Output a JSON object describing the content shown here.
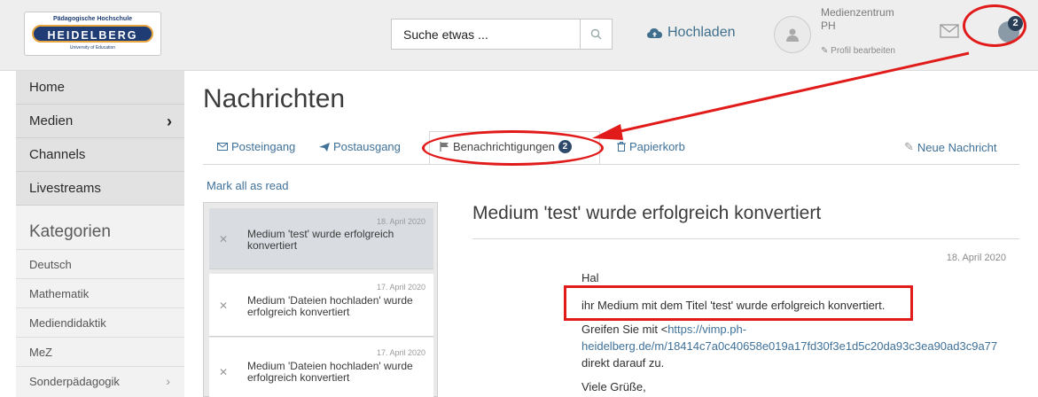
{
  "header": {
    "logo": {
      "top_text": "Pädagogische Hochschule",
      "name": "HEIDELBERG",
      "sub_text": "University of Education"
    },
    "search": {
      "placeholder": "Suche etwas ..."
    },
    "upload_label": "Hochladen",
    "user": {
      "name": "Medienzentrum PH",
      "edit_label": "Profil bearbeiten"
    },
    "notification_count": "2"
  },
  "sidebar": {
    "nav": [
      {
        "label": "Home"
      },
      {
        "label": "Medien",
        "has_submenu": true
      },
      {
        "label": "Channels"
      },
      {
        "label": "Livestreams"
      }
    ],
    "categories_title": "Kategorien",
    "categories": [
      {
        "label": "Deutsch"
      },
      {
        "label": "Mathematik"
      },
      {
        "label": "Mediendidaktik"
      },
      {
        "label": "MeZ"
      },
      {
        "label": "Sonderpädagogik",
        "has_submenu": true
      }
    ]
  },
  "main": {
    "title": "Nachrichten",
    "tabs": [
      {
        "label": "Posteingang",
        "icon": "envelope-icon"
      },
      {
        "label": "Postausgang",
        "icon": "send-icon"
      },
      {
        "label": "Benachrichtigungen",
        "icon": "flag-icon",
        "badge": "2",
        "active": true
      },
      {
        "label": "Papierkorb",
        "icon": "trash-icon"
      }
    ],
    "new_message_label": "Neue Nachricht",
    "mark_all_read": "Mark all as read",
    "messages": [
      {
        "date": "18. April 2020",
        "text": "Medium 'test' wurde erfolgreich konvertiert"
      },
      {
        "date": "17. April 2020",
        "text": "Medium 'Dateien hochladen' wurde erfolgreich konvertiert"
      },
      {
        "date": "17. April 2020",
        "text": "Medium 'Dateien hochladen' wurde erfolgreich konvertiert"
      }
    ],
    "detail": {
      "title": "Medium 'test' wurde erfolgreich konvertiert",
      "date": "18. April 2020",
      "greeting": "Hal",
      "line1": "ihr Medium mit dem Titel 'test' wurde erfolgreich konvertiert.",
      "line2_prefix": "Greifen Sie mit <",
      "link_part1": "https://vimp.ph-",
      "link_part2": "heidelberg.de/m/18414c7a0c40658e019a17fd30f3e1d5c20da93c3ea90ad3c9a77",
      "line2_suffix": "direkt darauf zu.",
      "closing": "Viele Grüße,"
    }
  },
  "colors": {
    "annotation": "#e11a1a",
    "link": "#3f7199",
    "badge": "#2f4a6b"
  }
}
